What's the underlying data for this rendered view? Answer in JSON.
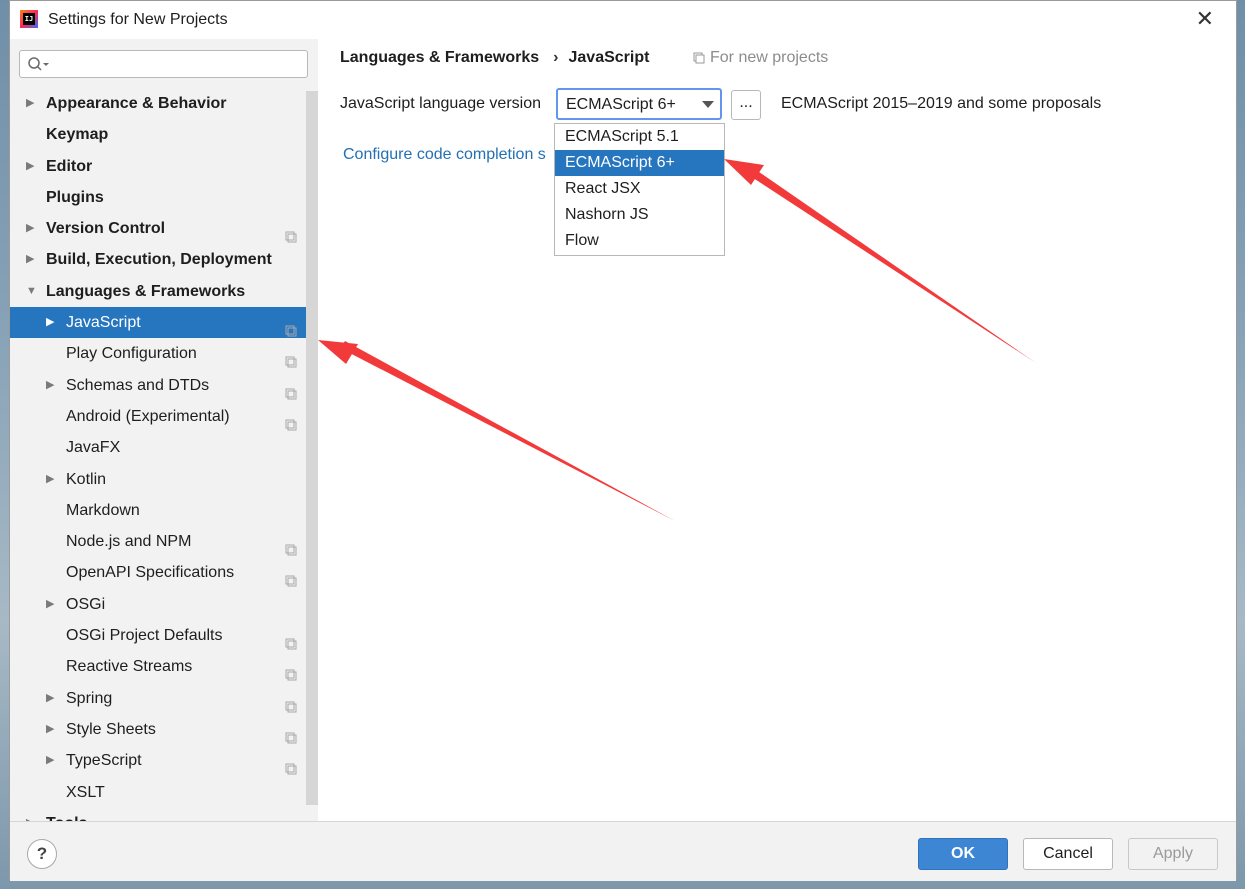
{
  "window": {
    "title": "Settings for New Projects",
    "app_icon_text": "IJ",
    "close_glyph": "✕"
  },
  "search": {
    "placeholder": "",
    "value": ""
  },
  "tree": [
    {
      "label": "Appearance & Behavior",
      "level": "top",
      "arrow": "▶",
      "copy": false,
      "selected": false
    },
    {
      "label": "Keymap",
      "level": "top",
      "arrow": "",
      "copy": false,
      "selected": false
    },
    {
      "label": "Editor",
      "level": "top",
      "arrow": "▶",
      "copy": false,
      "selected": false
    },
    {
      "label": "Plugins",
      "level": "top",
      "arrow": "",
      "copy": false,
      "selected": false
    },
    {
      "label": "Version Control",
      "level": "top",
      "arrow": "▶",
      "copy": true,
      "selected": false
    },
    {
      "label": "Build, Execution, Deployment",
      "level": "top",
      "arrow": "▶",
      "copy": false,
      "selected": false
    },
    {
      "label": "Languages & Frameworks",
      "level": "top",
      "arrow": "▼",
      "copy": false,
      "selected": false
    },
    {
      "label": "JavaScript",
      "level": "sub",
      "arrow": "▶",
      "copy": true,
      "selected": true
    },
    {
      "label": "Play Configuration",
      "level": "sub",
      "arrow": "",
      "copy": true,
      "selected": false
    },
    {
      "label": "Schemas and DTDs",
      "level": "sub",
      "arrow": "▶",
      "copy": true,
      "selected": false
    },
    {
      "label": "Android (Experimental)",
      "level": "sub",
      "arrow": "",
      "copy": true,
      "selected": false
    },
    {
      "label": "JavaFX",
      "level": "sub",
      "arrow": "",
      "copy": false,
      "selected": false
    },
    {
      "label": "Kotlin",
      "level": "sub",
      "arrow": "▶",
      "copy": false,
      "selected": false
    },
    {
      "label": "Markdown",
      "level": "sub",
      "arrow": "",
      "copy": false,
      "selected": false
    },
    {
      "label": "Node.js and NPM",
      "level": "sub",
      "arrow": "",
      "copy": true,
      "selected": false
    },
    {
      "label": "OpenAPI Specifications",
      "level": "sub",
      "arrow": "",
      "copy": true,
      "selected": false
    },
    {
      "label": "OSGi",
      "level": "sub",
      "arrow": "▶",
      "copy": false,
      "selected": false
    },
    {
      "label": "OSGi Project Defaults",
      "level": "sub",
      "arrow": "",
      "copy": true,
      "selected": false
    },
    {
      "label": "Reactive Streams",
      "level": "sub",
      "arrow": "",
      "copy": true,
      "selected": false
    },
    {
      "label": "Spring",
      "level": "sub",
      "arrow": "▶",
      "copy": true,
      "selected": false
    },
    {
      "label": "Style Sheets",
      "level": "sub",
      "arrow": "▶",
      "copy": true,
      "selected": false
    },
    {
      "label": "TypeScript",
      "level": "sub",
      "arrow": "▶",
      "copy": true,
      "selected": false
    },
    {
      "label": "XSLT",
      "level": "sub",
      "arrow": "",
      "copy": false,
      "selected": false
    },
    {
      "label": "Tools",
      "level": "top",
      "arrow": "▶",
      "copy": false,
      "selected": false
    }
  ],
  "breadcrumb": {
    "parent": "Languages & Frameworks",
    "separator": "›",
    "current": "JavaScript",
    "scope_note": "For new projects"
  },
  "language_version": {
    "label": "JavaScript language version",
    "selected": "ECMAScript 6+",
    "ellipsis": "...",
    "description": "ECMAScript 2015–2019 and some proposals",
    "options": [
      "ECMAScript 5.1",
      "ECMAScript 6+",
      "React JSX",
      "Nashorn JS",
      "Flow"
    ],
    "selected_index": 1
  },
  "config_link": "Configure code completion s",
  "footer": {
    "help": "?",
    "ok": "OK",
    "cancel": "Cancel",
    "apply": "Apply"
  },
  "annotation_color": "#f23a3a"
}
